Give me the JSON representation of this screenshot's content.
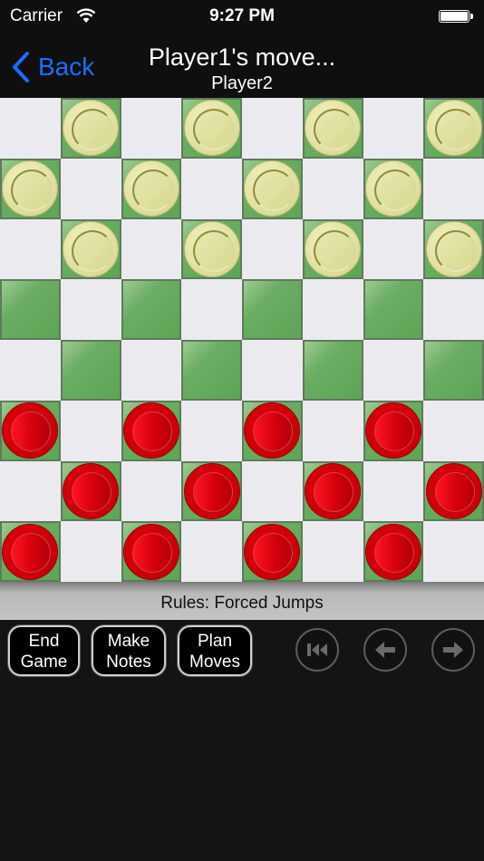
{
  "status_bar": {
    "carrier": "Carrier",
    "time": "9:27 PM",
    "battery_level": 1.0
  },
  "nav": {
    "back_label": "Back",
    "title": "Player1's move...",
    "subtitle": "Player2"
  },
  "colors": {
    "accent": "#1a6dff",
    "dark_square": "#5ea456",
    "light_square": "#ebebef",
    "red_piece": "#d4000c",
    "cream_piece": "#e2e2a4"
  },
  "board": {
    "size": 8,
    "rows": [
      [
        "",
        "cream",
        "",
        "cream",
        "",
        "cream",
        "",
        "cream"
      ],
      [
        "cream",
        "",
        "cream",
        "",
        "cream",
        "",
        "cream",
        ""
      ],
      [
        "",
        "cream",
        "",
        "cream",
        "",
        "cream",
        "",
        "cream"
      ],
      [
        "",
        "",
        "",
        "",
        "",
        "",
        "",
        ""
      ],
      [
        "",
        "",
        "",
        "",
        "",
        "",
        "",
        ""
      ],
      [
        "red",
        "",
        "red",
        "",
        "red",
        "",
        "red",
        ""
      ],
      [
        "",
        "red",
        "",
        "red",
        "",
        "red",
        "",
        "red"
      ],
      [
        "red",
        "",
        "red",
        "",
        "red",
        "",
        "red",
        ""
      ]
    ]
  },
  "rules": {
    "text": "Rules: Forced Jumps"
  },
  "toolbar": {
    "end_game": [
      "End",
      "Game"
    ],
    "make_notes": [
      "Make",
      "Notes"
    ],
    "plan_moves": [
      "Plan",
      "Moves"
    ],
    "icons": [
      "rewind-to-start-icon",
      "arrow-left-icon",
      "arrow-right-icon"
    ]
  }
}
